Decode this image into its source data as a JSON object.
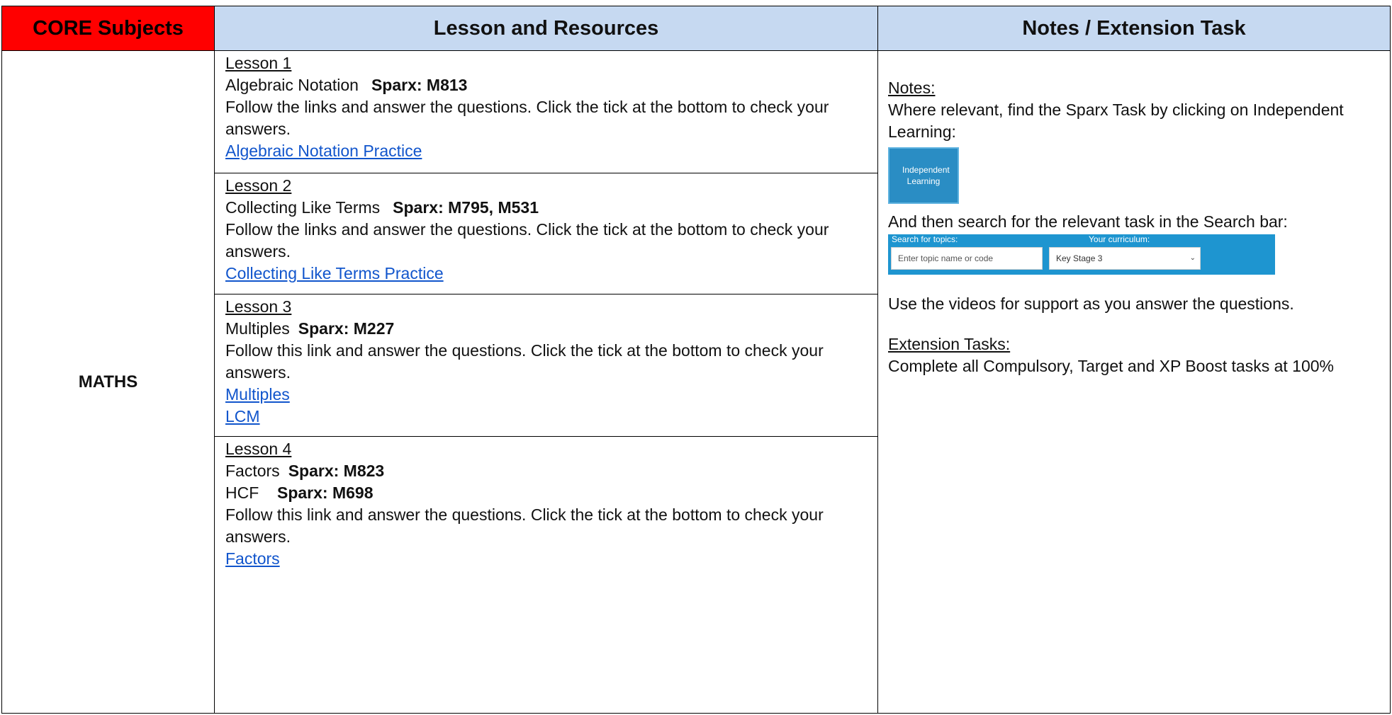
{
  "headers": {
    "core": "CORE Subjects",
    "lesson": "Lesson and Resources",
    "notes": "Notes / Extension Task"
  },
  "subject": "MATHS",
  "lessons": [
    {
      "title": "Lesson 1",
      "topic": "Algebraic Notation",
      "sparx": "Sparx: M813",
      "instructions": "Follow the links and answer the questions. Click the tick at the bottom to check your answers.",
      "links": [
        "Algebraic Notation Practice"
      ]
    },
    {
      "title": "Lesson 2",
      "topic": "Collecting Like Terms",
      "sparx": "Sparx: M795, M531",
      "instructions": "Follow the links and answer the questions. Click the tick at the bottom to check your answers.",
      "links": [
        "Collecting Like Terms Practice"
      ]
    },
    {
      "title": "Lesson 3",
      "topic": "Multiples",
      "sparx": "Sparx: M227",
      "instructions": "Follow this link and answer the questions. Click the tick at the bottom to check your answers.",
      "links": [
        "Multiples",
        "LCM"
      ]
    },
    {
      "title": "Lesson 4",
      "topic": "Factors",
      "sparx": "Sparx: M823",
      "topic2": "HCF",
      "sparx2": "Sparx: M698",
      "instructions": "Follow this link and answer the questions. Click the tick at the bottom to check your answers.",
      "links": [
        "Factors"
      ]
    }
  ],
  "notes": {
    "notes_heading": "Notes:",
    "notes_text": "Where relevant, find the Sparx Task by clicking on Independent Learning:",
    "il_button": "Independent Learning",
    "search_intro": "And then search for the relevant task in the Search bar:",
    "search_label": "Search for topics:",
    "search_placeholder": "Enter topic name or code",
    "curriculum_label": "Your curriculum:",
    "curriculum_value": "Key Stage 3",
    "videos_text": "Use the videos for support as you answer the questions.",
    "extension_heading": "Extension Tasks:",
    "extension_text": "Complete all Compulsory, Target and XP Boost tasks at 100%"
  },
  "colors": {
    "core_header_bg": "#ff0000",
    "header_bg": "#c6d9f1",
    "link": "#1155cc",
    "sparx_bar": "#1e95d0"
  }
}
